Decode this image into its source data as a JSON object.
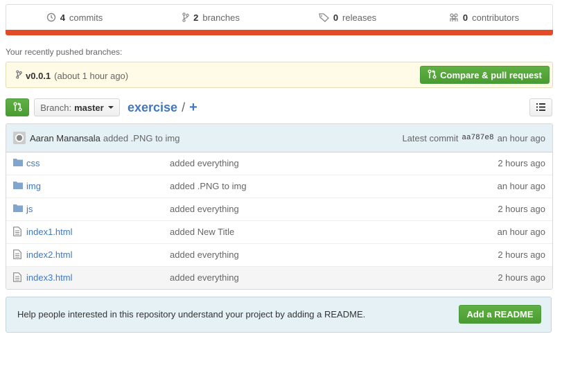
{
  "summary": {
    "commits": {
      "count": "4",
      "label": "commits"
    },
    "branches": {
      "count": "2",
      "label": "branches"
    },
    "releases": {
      "count": "0",
      "label": "releases"
    },
    "contributors": {
      "count": "0",
      "label": "contributors"
    }
  },
  "language_bar_color": "#e34c26",
  "pushed": {
    "label": "Your recently pushed branches:",
    "branch": "v0.0.1",
    "time": "(about 1 hour ago)",
    "compare_label": "Compare & pull request"
  },
  "nav": {
    "branch_prefix": "Branch:",
    "branch_name": "master",
    "repo": "exercise",
    "sep": "/",
    "plus": "+"
  },
  "latest_commit": {
    "author": "Aaran Manansala",
    "message": "added .PNG to img",
    "label": "Latest commit",
    "sha": "aa787e8",
    "time": "an hour ago"
  },
  "files": [
    {
      "type": "dir",
      "name": "css",
      "message": "added everything",
      "age": "2 hours ago"
    },
    {
      "type": "dir",
      "name": "img",
      "message": "added .PNG to img",
      "age": "an hour ago"
    },
    {
      "type": "dir",
      "name": "js",
      "message": "added everything",
      "age": "2 hours ago"
    },
    {
      "type": "file",
      "name": "index1.html",
      "message": "added New Title",
      "age": "an hour ago"
    },
    {
      "type": "file",
      "name": "index2.html",
      "message": "added everything",
      "age": "2 hours ago"
    },
    {
      "type": "file",
      "name": "index3.html",
      "message": "added everything",
      "age": "2 hours ago"
    }
  ],
  "readme": {
    "text": "Help people interested in this repository understand your project by adding a README.",
    "button": "Add a README"
  }
}
